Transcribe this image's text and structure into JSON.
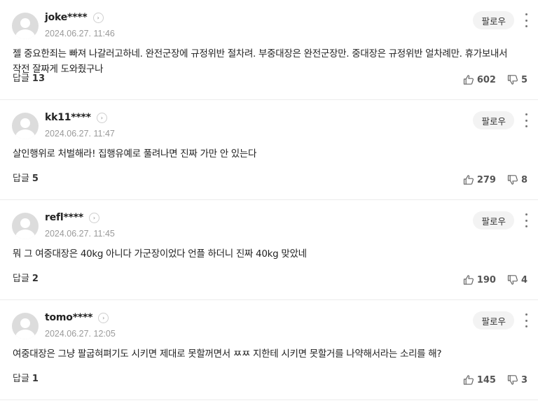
{
  "labels": {
    "follow": "팔로우",
    "reply": "답글"
  },
  "comments": [
    {
      "nickname": "joke****",
      "date": "2024.06.27. 11:46",
      "text": "젤 중요한죄는 빠져 나갈러고하네. 완전군장에 규정위반 절차려. 부중대장은 완전군장만. 중대장은 규정위반 얼차례만. 휴가보내서 작전 잘짜게 도와줬구나",
      "replies": "13",
      "likes": "602",
      "dislikes": "5"
    },
    {
      "nickname": "kk11****",
      "date": "2024.06.27. 11:47",
      "text": "살인행위로 처벌해라! 집행유예로 풀려나면 진짜 가만 안 있는다",
      "replies": "5",
      "likes": "279",
      "dislikes": "8"
    },
    {
      "nickname": "refl****",
      "date": "2024.06.27. 11:45",
      "text": "뭐 그 여중대장은 40kg 아니다 가군장이었다 언플 하더니 진짜 40kg 맞았네",
      "replies": "2",
      "likes": "190",
      "dislikes": "4"
    },
    {
      "nickname": "tomo****",
      "date": "2024.06.27. 12:05",
      "text": "여중대장은 그냥 팔굽혀펴기도 시키면 제대로 못할꺼면서 ㅉㅉ 지한테 시키면 못할거를 나약해서라는 소리를 해?",
      "replies": "1",
      "likes": "145",
      "dislikes": "3"
    }
  ]
}
